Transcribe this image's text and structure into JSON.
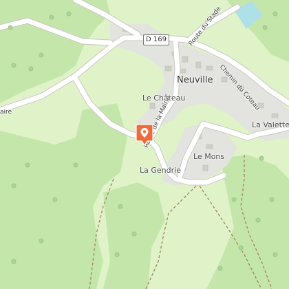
{
  "map": {
    "places": {
      "town": "Neuville",
      "chateau": "Le Château",
      "valette": "La Valette",
      "mons": "Le Mons",
      "gendrie": "La Gendrie"
    },
    "roads": {
      "shield": "D 169",
      "stade": "Route du Stade",
      "mairie": "Route de la Mairie",
      "coteau": "Chemin du Coteau",
      "edge_fragment": "aire"
    },
    "marker": {
      "icon": "location-pin-icon",
      "color": "#ef6c3a"
    },
    "colors": {
      "meadow": "#dff2c8",
      "forest": "#bfe3a6",
      "settlement": "#e3e3df",
      "road": "#ffffff",
      "water": "#aee0e8",
      "trail": "#a88a5e"
    }
  }
}
